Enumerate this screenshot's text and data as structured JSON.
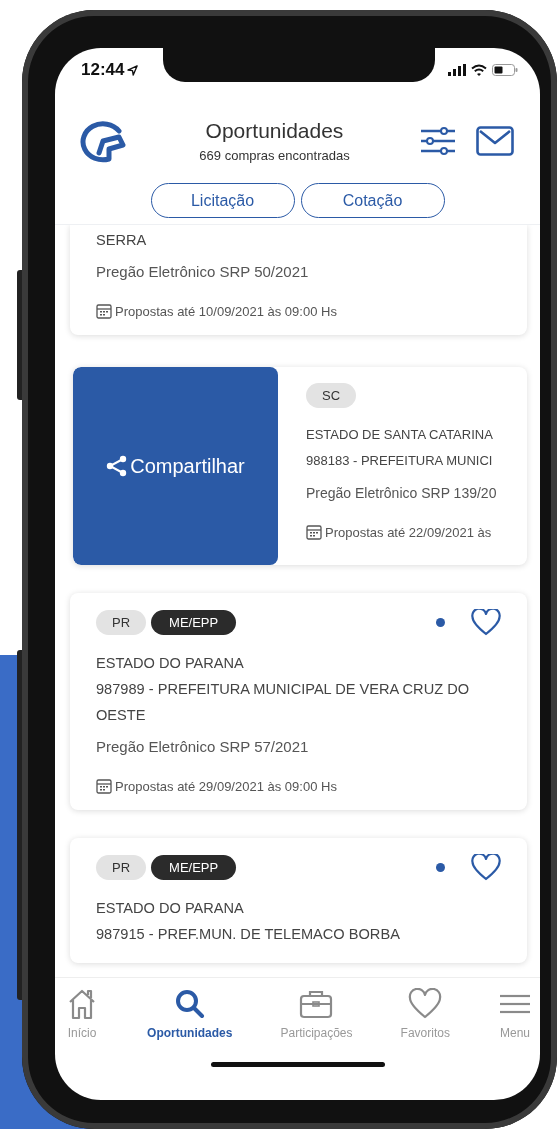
{
  "status_bar": {
    "time": "12:44"
  },
  "header": {
    "title": "Oportunidades",
    "subtitle": "669 compras encontradas"
  },
  "segments": [
    {
      "label": "Licitação"
    },
    {
      "label": "Cotação"
    }
  ],
  "cards": [
    {
      "swiped": false,
      "lines": [
        "SERRA"
      ],
      "modality": "Pregão Eletrônico SRP 50/2021",
      "deadline": "Propostas até 10/09/2021 às 09:00 Hs"
    },
    {
      "swiped": true,
      "action": "Compartilhar",
      "tags": [
        {
          "label": "SC",
          "kind": "uf"
        }
      ],
      "lines": [
        "ESTADO DE SANTA CATARINA",
        "988183 - PREFEITURA MUNICI"
      ],
      "modality": "Pregão Eletrônico SRP 139/20",
      "deadline": "Propostas até 22/09/2021 às"
    },
    {
      "swiped": false,
      "tags": [
        {
          "label": "PR",
          "kind": "uf"
        },
        {
          "label": "ME/EPP",
          "kind": "benefit"
        }
      ],
      "new": true,
      "favorite": false,
      "lines": [
        "ESTADO DO PARANA",
        "987989 - PREFEITURA MUNICIPAL DE VERA CRUZ DO OESTE"
      ],
      "modality": "Pregão Eletrônico SRP 57/2021",
      "deadline": "Propostas até 29/09/2021 às 09:00 Hs"
    },
    {
      "swiped": false,
      "tags": [
        {
          "label": "PR",
          "kind": "uf"
        },
        {
          "label": "ME/EPP",
          "kind": "benefit"
        }
      ],
      "new": true,
      "favorite": false,
      "lines": [
        "ESTADO DO PARANA",
        "987915 - PREF.MUN. DE TELEMACO BORBA"
      ]
    }
  ],
  "nav": [
    {
      "label": "Início",
      "kind": "home",
      "selected": false
    },
    {
      "label": "Oportunidades",
      "kind": "search",
      "selected": true
    },
    {
      "label": "Participações",
      "kind": "briefcase",
      "selected": false
    },
    {
      "label": "Favoritos",
      "kind": "heart",
      "selected": false
    },
    {
      "label": "Menu",
      "kind": "menu",
      "selected": false
    }
  ]
}
